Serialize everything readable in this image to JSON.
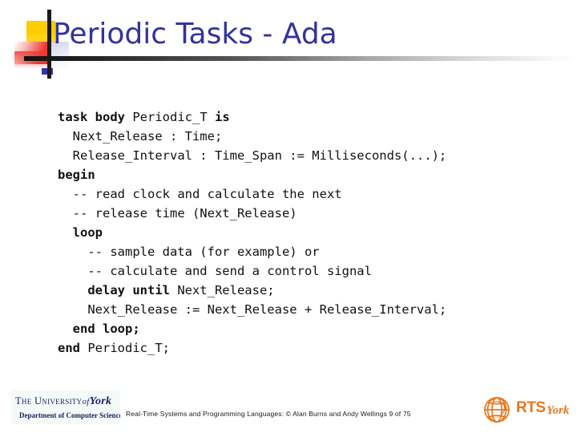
{
  "slide": {
    "title": "Periodic Tasks - Ada",
    "title_color": "#333399",
    "background": "#ffffff"
  },
  "decoration": {
    "yellow_color": "#ffcc00",
    "red_color": "#ef3a33",
    "blue_color": "#3333aa",
    "bar_color": "#1a1a1a"
  },
  "code": {
    "language": "Ada",
    "lines": [
      {
        "indent": 0,
        "tokens": [
          {
            "t": "task body ",
            "b": true
          },
          {
            "t": "Periodic_T ",
            "b": false
          },
          {
            "t": "is",
            "b": true
          }
        ]
      },
      {
        "indent": 1,
        "tokens": [
          {
            "t": "Next_Release : Time;",
            "b": false
          }
        ]
      },
      {
        "indent": 1,
        "tokens": [
          {
            "t": "Release_Interval : Time_Span := Milliseconds(...);",
            "b": false
          }
        ]
      },
      {
        "indent": 0,
        "tokens": [
          {
            "t": "begin",
            "b": true
          }
        ]
      },
      {
        "indent": 1,
        "tokens": [
          {
            "t": "-- read clock and calculate the next",
            "b": false
          }
        ]
      },
      {
        "indent": 1,
        "tokens": [
          {
            "t": "-- release time (Next_Release)",
            "b": false
          }
        ]
      },
      {
        "indent": 1,
        "tokens": [
          {
            "t": "loop",
            "b": true
          }
        ]
      },
      {
        "indent": 2,
        "tokens": [
          {
            "t": "-- sample data (for example) or",
            "b": false
          }
        ]
      },
      {
        "indent": 2,
        "tokens": [
          {
            "t": "-- calculate and send a control signal",
            "b": false
          }
        ]
      },
      {
        "indent": 2,
        "tokens": [
          {
            "t": "delay until ",
            "b": true
          },
          {
            "t": "Next_Release;",
            "b": false
          }
        ]
      },
      {
        "indent": 2,
        "tokens": [
          {
            "t": "Next_Release := Next_Release + Release_Interval;",
            "b": false
          }
        ]
      },
      {
        "indent": 1,
        "tokens": [
          {
            "t": "end loop;",
            "b": true
          }
        ]
      },
      {
        "indent": 0,
        "tokens": [
          {
            "t": "end ",
            "b": true
          },
          {
            "t": "Periodic_T;",
            "b": false
          }
        ]
      }
    ]
  },
  "footer": {
    "university_line1_the": "The University",
    "university_line1_of": "of",
    "university_line1_york": "York",
    "university_line2": "Department of Computer Science",
    "center_text": "Real-Time Systems and Programming Languages: © Alan Burns and Andy Wellings 9 of 75",
    "rts_label": "RTS",
    "rts_york": "York",
    "rts_color": "#e8761a"
  }
}
